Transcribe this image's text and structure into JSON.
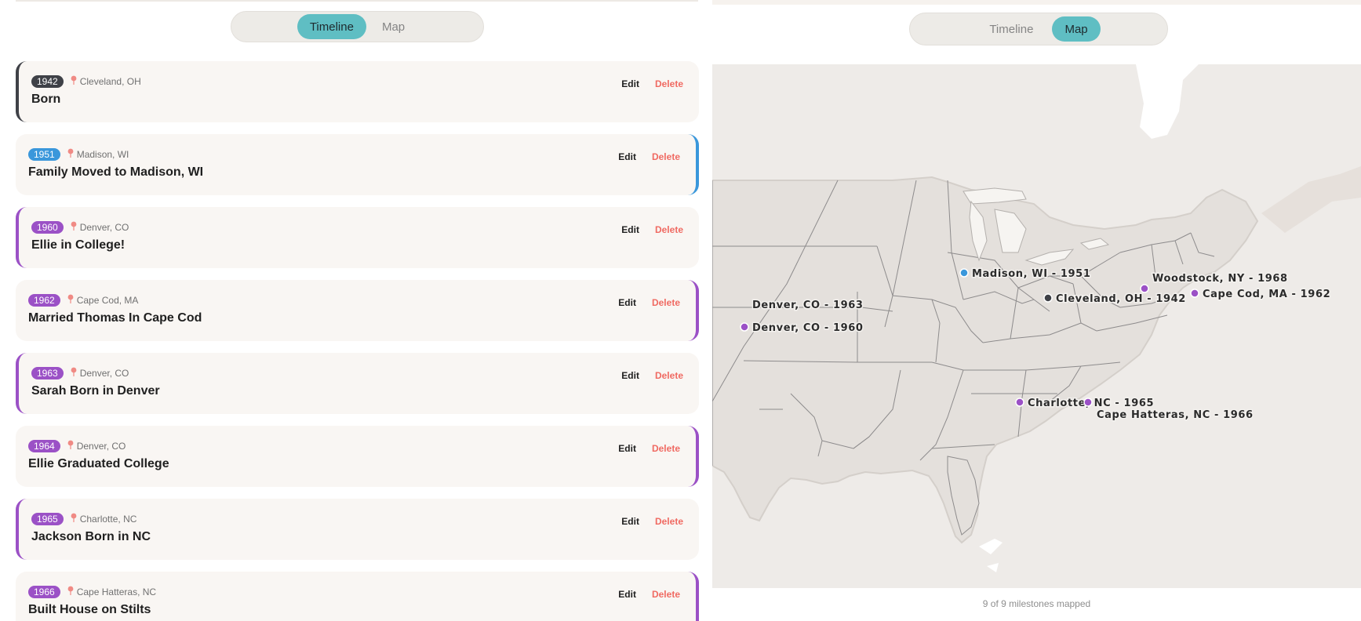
{
  "left_toggle": {
    "timeline_label": "Timeline",
    "map_label": "Map",
    "active": "Timeline"
  },
  "right_toggle": {
    "timeline_label": "Timeline",
    "map_label": "Map",
    "active": "Map"
  },
  "milestones": [
    {
      "year": "1942",
      "location": "Cleveland, OH",
      "title": "Born",
      "color": "#3f4147",
      "border_side": "left"
    },
    {
      "year": "1951",
      "location": "Madison, WI",
      "title": "Family Moved to Madison, WI",
      "color": "#3a97db",
      "border_side": "right"
    },
    {
      "year": "1960",
      "location": "Denver, CO",
      "title": "Ellie in College!",
      "color": "#9b51c6",
      "border_side": "left"
    },
    {
      "year": "1962",
      "location": "Cape Cod, MA",
      "title": "Married Thomas In Cape Cod",
      "color": "#9b51c6",
      "border_side": "right"
    },
    {
      "year": "1963",
      "location": "Denver, CO",
      "title": "Sarah Born in Denver",
      "color": "#9b51c6",
      "border_side": "left"
    },
    {
      "year": "1964",
      "location": "Denver, CO",
      "title": "Ellie Graduated College",
      "color": "#9b51c6",
      "border_side": "right"
    },
    {
      "year": "1965",
      "location": "Charlotte, NC",
      "title": "Jackson Born in NC",
      "color": "#9b51c6",
      "border_side": "left"
    },
    {
      "year": "1966",
      "location": "Cape Hatteras, NC",
      "title": "Built House on Stilts",
      "color": "#9b51c6",
      "border_side": "right"
    }
  ],
  "card_actions": {
    "edit_label": "Edit",
    "delete_label": "Delete"
  },
  "map_markers": [
    {
      "label": "Madison, WI - 1951",
      "color": "#3a97db"
    },
    {
      "label": "Cleveland, OH - 1942",
      "color": "#3f4147"
    },
    {
      "label": "Woodstock, NY - 1968",
      "color": "#9b51c6"
    },
    {
      "label": "Cape Cod, MA - 1962",
      "color": "#9b51c6"
    },
    {
      "label": "Denver, CO - 1963",
      "color": "#9b51c6"
    },
    {
      "label": "Denver, CO - 1960",
      "color": "#9b51c6"
    },
    {
      "label": "Charlotte, NC - 1965",
      "color": "#9b51c6"
    },
    {
      "label": "Cape Hatteras, NC - 1966",
      "color": "#9b51c6"
    }
  ],
  "map_footer": "9 of 9 milestones mapped",
  "colors": {
    "accent": "#5fbec3",
    "delete": "#f06a62",
    "pin": "#f08a84"
  }
}
